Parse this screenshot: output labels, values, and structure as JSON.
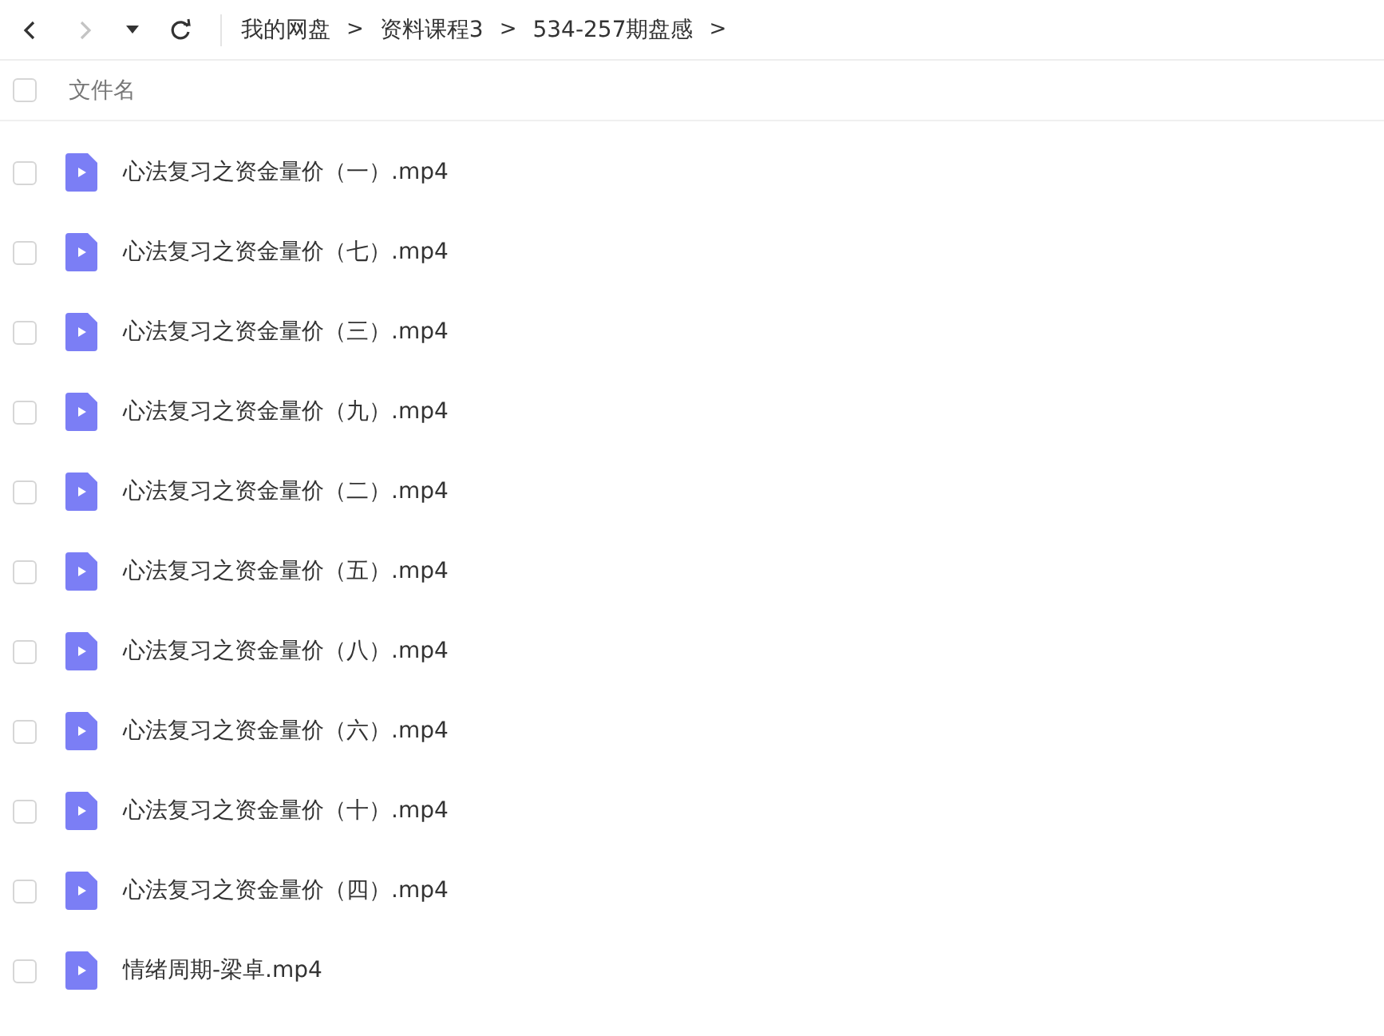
{
  "toolbar": {
    "back": {
      "disabled": false
    },
    "forward": {
      "disabled": true
    },
    "breadcrumbs": [
      {
        "label": "我的网盘",
        "separator": ">"
      },
      {
        "label": "资料课程3",
        "separator": ">"
      },
      {
        "label": "534-257期盘感",
        "separator": ">"
      }
    ]
  },
  "header": {
    "checked": false,
    "label": "文件名"
  },
  "files": [
    {
      "name": "心法复习之资金量价（一）.mp4",
      "kind": "video",
      "checked": false
    },
    {
      "name": "心法复习之资金量价（七）.mp4",
      "kind": "video",
      "checked": false
    },
    {
      "name": "心法复习之资金量价（三）.mp4",
      "kind": "video",
      "checked": false
    },
    {
      "name": "心法复习之资金量价（九）.mp4",
      "kind": "video",
      "checked": false
    },
    {
      "name": "心法复习之资金量价（二）.mp4",
      "kind": "video",
      "checked": false
    },
    {
      "name": "心法复习之资金量价（五）.mp4",
      "kind": "video",
      "checked": false
    },
    {
      "name": "心法复习之资金量价（八）.mp4",
      "kind": "video",
      "checked": false
    },
    {
      "name": "心法复习之资金量价（六）.mp4",
      "kind": "video",
      "checked": false
    },
    {
      "name": "心法复习之资金量价（十）.mp4",
      "kind": "video",
      "checked": false
    },
    {
      "name": "心法复习之资金量价（四）.mp4",
      "kind": "video",
      "checked": false
    },
    {
      "name": "情绪周期-梁卓.mp4",
      "kind": "video",
      "checked": false
    }
  ]
}
